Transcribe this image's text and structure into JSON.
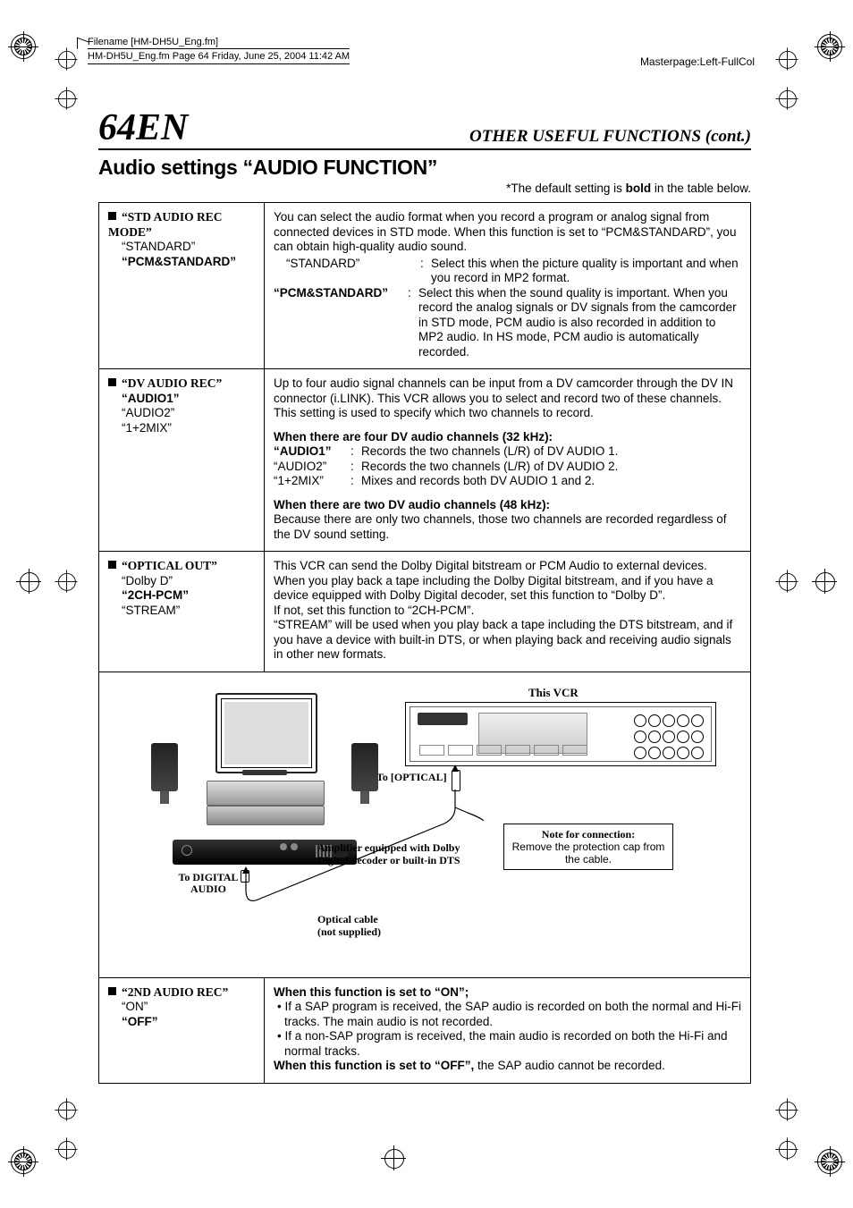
{
  "meta": {
    "filename_line1": "Filename [HM-DH5U_Eng.fm]",
    "filename_line2": "HM-DH5U_Eng.fm  Page 64  Friday, June 25, 2004  11:42 AM",
    "masterpage": "Masterpage:Left-FullCol"
  },
  "header": {
    "page_number": "64",
    "page_suffix": "EN",
    "section_header": "OTHER USEFUL FUNCTIONS (cont.)"
  },
  "title": "Audio settings “AUDIO FUNCTION”",
  "default_note_prefix": "*The default setting is ",
  "default_note_bold": "bold",
  "default_note_suffix": " in the table below.",
  "rows": {
    "std_audio": {
      "name": "“STD AUDIO REC MODE”",
      "opts": [
        "“STANDARD”",
        "“PCM&STANDARD”"
      ],
      "default_index": 1,
      "desc_intro": "You can select the audio format when you record a program or analog signal from connected devices in STD mode. When this function is set to “PCM&STANDARD”, you can obtain high-quality audio sound.",
      "items": [
        {
          "label": "“STANDARD”",
          "bold": false,
          "text": "Select this when the picture quality is important and when you record in MP2 format."
        },
        {
          "label": "“PCM&STANDARD”",
          "bold": true,
          "text": "Select this when the sound quality is important. When you record the analog signals or DV signals from the camcorder in STD mode, PCM audio is also recorded in addition to MP2 audio. In HS mode, PCM audio is automatically recorded."
        }
      ]
    },
    "dv_audio": {
      "name": "“DV AUDIO REC”",
      "opts": [
        "“AUDIO1”",
        "“AUDIO2”",
        "“1+2MIX”"
      ],
      "default_index": 0,
      "desc_intro": "Up to four audio signal channels can be input from a DV camcorder through the DV IN connector (i.LINK). This VCR allows you to select and record two of these channels. This setting is used to specify which two channels to record.",
      "sub4_title": "When there are four DV audio channels (32 kHz):",
      "sub4_items": [
        {
          "label": "“AUDIO1”",
          "bold": true,
          "text": "Records the two channels (L/R) of DV AUDIO 1."
        },
        {
          "label": "“AUDIO2”",
          "bold": false,
          "text": "Records the two channels (L/R) of DV AUDIO 2."
        },
        {
          "label": "“1+2MIX”",
          "bold": false,
          "text": "Mixes and records both DV AUDIO 1 and 2."
        }
      ],
      "sub2_title": "When there are two DV audio channels (48 kHz):",
      "sub2_text": "Because there are only two channels, those two channels are recorded regardless of the DV sound setting."
    },
    "optical": {
      "name": "“OPTICAL OUT”",
      "opts": [
        "“Dolby D”",
        "“2CH-PCM”",
        "“STREAM”"
      ],
      "default_index": 1,
      "text": "This VCR can send the Dolby Digital bitstream or PCM Audio to external devices. When you play back a tape including the Dolby Digital bitstream, and if you have a device equipped with Dolby Digital decoder, set this function to “Dolby D”.\nIf not, set this function to “2CH-PCM”.\n“STREAM” will be used when you play back a tape including the DTS bitstream, and if you have a device with built-in DTS, or when playing back and receiving audio signals in other new formats."
    },
    "second_audio": {
      "name": "“2ND AUDIO REC”",
      "opts": [
        "“ON”",
        "“OFF”"
      ],
      "default_index": 1,
      "on_title": "When this function is set to “ON”;",
      "on_b1": "If a SAP program is received, the SAP audio is recorded on both the normal and Hi-Fi tracks. The main audio is not recorded.",
      "on_b2": "If a non-SAP program is received, the main audio is recorded on both the Hi-Fi and normal tracks.",
      "off_title_pre": "When this function is set to “OFF”,",
      "off_text": " the SAP audio cannot be recorded."
    }
  },
  "diagram": {
    "this_vcr": "This VCR",
    "to_optical": "To [OPTICAL]",
    "to_digital_1": "To DIGITAL",
    "to_digital_2": "AUDIO",
    "amp_label": "Amplifier equipped with Dolby Digital decoder or built-in DTS",
    "cable_label_1": "Optical cable",
    "cable_label_2": "(not supplied)",
    "note_title": "Note for connection:",
    "note_body": "Remove the protection cap from the cable."
  }
}
